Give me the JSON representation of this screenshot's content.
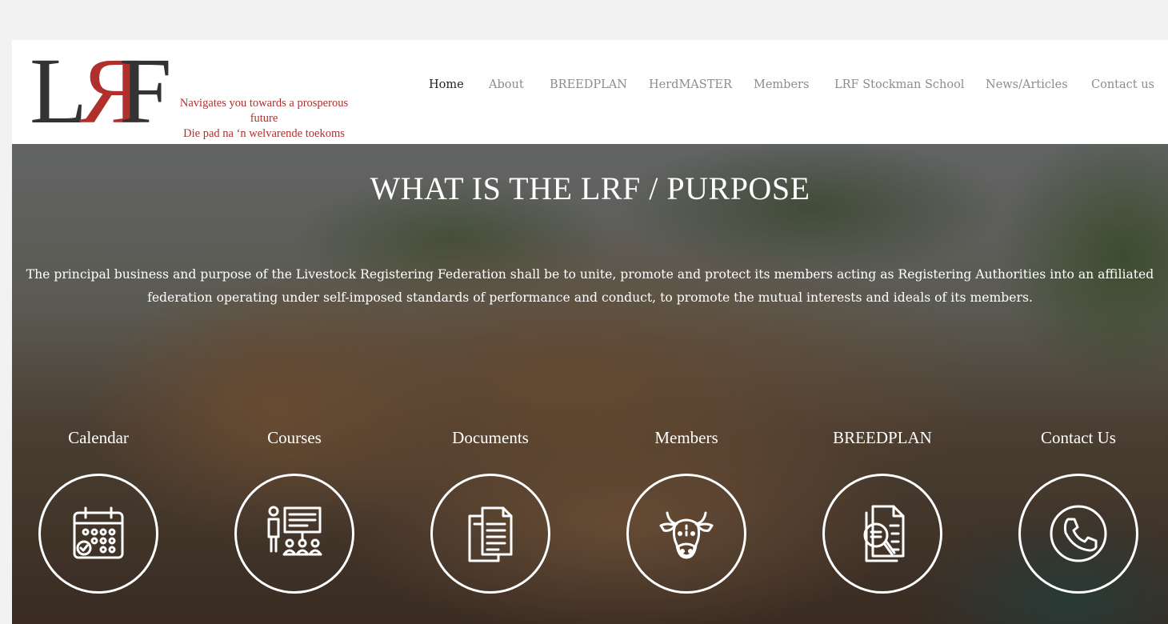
{
  "logo": {
    "letters": [
      "L",
      "R",
      "F"
    ],
    "tagline_en": "Navigates you towards a prosperous future",
    "tagline_af": "Die pad na ‘n welvarende toekoms",
    "colors": {
      "dark": "#333333",
      "red": "#b0302c"
    }
  },
  "nav": {
    "items": [
      {
        "label": "Home",
        "active": true
      },
      {
        "label": "About",
        "active": false
      },
      {
        "label": "BREEDPLAN",
        "active": false
      },
      {
        "label": "HerdMASTER",
        "active": false
      },
      {
        "label": "Members",
        "active": false
      },
      {
        "label": "LRF Stockman School",
        "active": false
      },
      {
        "label": "News/Articles",
        "active": false
      },
      {
        "label": "Contact us",
        "active": false
      }
    ]
  },
  "hero": {
    "title": "WHAT IS THE LRF / PURPOSE",
    "text": "The principal business and purpose of the Livestock Registering Federation shall be to unite, promote and protect its members acting as Registering Authorities into an affiliated federation operating under self-imposed standards of performance and conduct, to promote the mutual interests and ideals of its members."
  },
  "tiles": [
    {
      "label": "Calendar",
      "icon": "calendar-icon"
    },
    {
      "label": "Courses",
      "icon": "presentation-icon"
    },
    {
      "label": "Documents",
      "icon": "documents-icon"
    },
    {
      "label": "Members",
      "icon": "cow-head-icon"
    },
    {
      "label": "BREEDPLAN",
      "icon": "document-search-icon"
    },
    {
      "label": "Contact Us",
      "icon": "phone-icon"
    }
  ]
}
